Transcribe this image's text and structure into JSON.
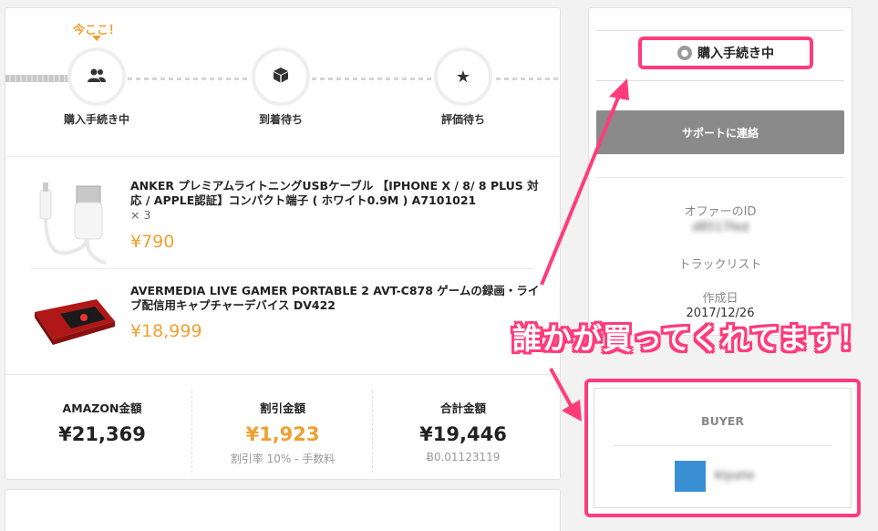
{
  "progress": {
    "current_marker": "今ここ！",
    "steps": [
      {
        "label": "購入手続き中",
        "icon": "users-icon"
      },
      {
        "label": "到着待ち",
        "icon": "box-icon"
      },
      {
        "label": "評価待ち",
        "icon": "star-icon"
      }
    ]
  },
  "items": [
    {
      "title": "ANKER プレミアムライトニングUSBケーブル 【IPHONE X / 8/ 8 PLUS 対応 / APPLE認証】コンパクト端子 ( ホワイト0.9M ) A7101021",
      "qty": "× 3",
      "price": "¥790"
    },
    {
      "title": "AVERMEDIA LIVE GAMER PORTABLE 2 AVT-C878 ゲームの録画・ライブ配信用キャプチャーデバイス DV422",
      "qty": "",
      "price": "¥18,999"
    }
  ],
  "totals": {
    "amazon": {
      "label": "AMAZON金額",
      "value": "¥21,369"
    },
    "discount": {
      "label": "割引金額",
      "value": "¥1,923",
      "sub": "割引率 10% - 手数料"
    },
    "total": {
      "label": "合計金額",
      "value": "¥19,446",
      "sub": "Ƀ0.01123119"
    }
  },
  "sidebar": {
    "status": "購入手続き中",
    "support_button": "サポートに連絡",
    "offer_id_label": "オファーのID",
    "offer_id_value": "d8517fed",
    "tracklist_label": "トラックリスト",
    "created_label": "作成日",
    "created_value": "2017/12/26",
    "buyer_label": "BUYER",
    "buyer_name": "kiyuno"
  },
  "annotation": "誰かが買ってくれてます！",
  "colors": {
    "accent": "#f0a030",
    "highlight": "#ff3c7a",
    "button": "#8a8a8a"
  }
}
